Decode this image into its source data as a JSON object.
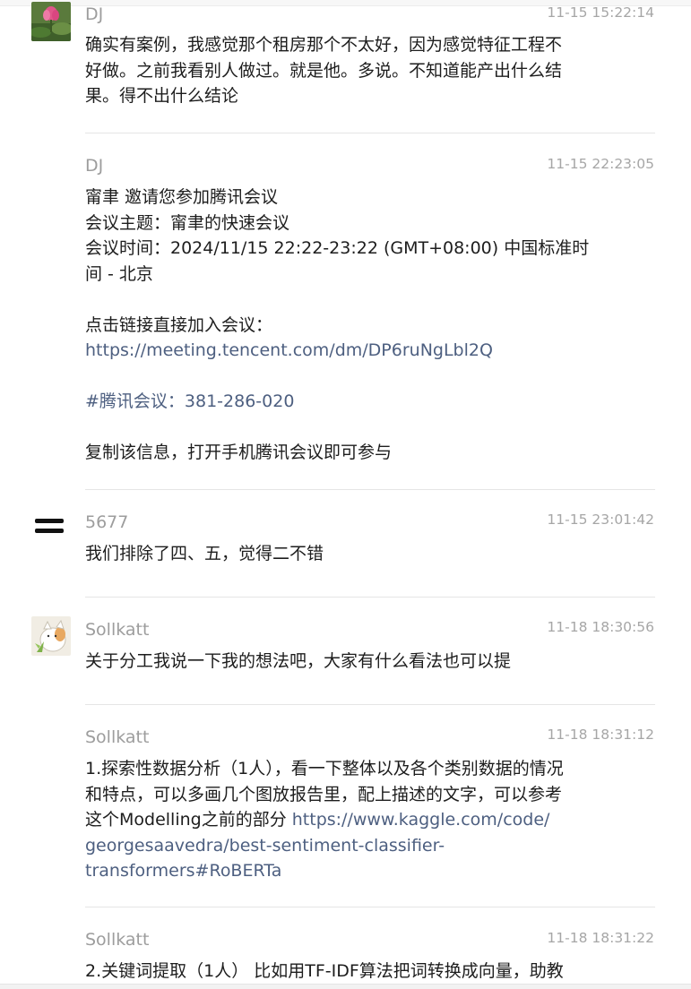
{
  "messages": [
    {
      "sender": "DJ",
      "time": "11-15 15:22:14",
      "avatar": "lotus-flower-avatar",
      "lines": [
        "确实有案例，我感觉那个租房那个不太好，因为感觉特征工程不",
        "好做。之前我看别人做过。就是他。多说。不知道能产出什么结",
        "果。得不出什么结论"
      ]
    },
    {
      "sender": "DJ",
      "time": "11-15 22:23:05",
      "lines": [
        "甯聿 邀请您参加腾讯会议",
        "会议主题：甯聿的快速会议",
        "会议时间：2024/11/15 22:22-23:22 (GMT+08:00) 中国标准时",
        "间 - 北京",
        "",
        "点击链接直接加入会议：",
        "https://meeting.tencent.com/dm/DP6ruNgLbl2Q",
        "",
        "#腾讯会议：381-286-020",
        "",
        "复制该信息，打开手机腾讯会议即可参与"
      ]
    },
    {
      "sender": "5677",
      "time": "11-15 23:01:42",
      "avatar": "equals-sign-avatar",
      "lines": [
        "我们排除了四、五，觉得二不错"
      ]
    },
    {
      "sender": "Sollkatt",
      "time": "11-18 18:30:56",
      "avatar": "cat-avatar",
      "lines": [
        "关于分工我说一下我的想法吧，大家有什么看法也可以提"
      ]
    },
    {
      "sender": "Sollkatt",
      "time": "11-18 18:31:12",
      "line1": "1.探索性数据分析（1人），看一下整体以及各个类别数据的情况",
      "line2": "和特点，可以多画几个图放报告里，配上描述的文字，可以参考",
      "line3_text": "这个Modelling之前的部分 ",
      "line3_link": "https://www.kaggle.com/code/",
      "line4": "georgesaavedra/best-sentiment-classifier-",
      "line5": "transformers#RoBERTa"
    },
    {
      "sender": "Sollkatt",
      "time": "11-18 18:31:22",
      "lines": [
        "2.关键词提取（1人） 比如用TF-IDF算法把词转换成向量，助教"
      ]
    }
  ],
  "colors": {
    "sender": "#9d9d9d",
    "time": "#a6a6a6",
    "text": "#1d1d1d",
    "link": "#4d5f80",
    "divider": "#e5e5e5"
  }
}
